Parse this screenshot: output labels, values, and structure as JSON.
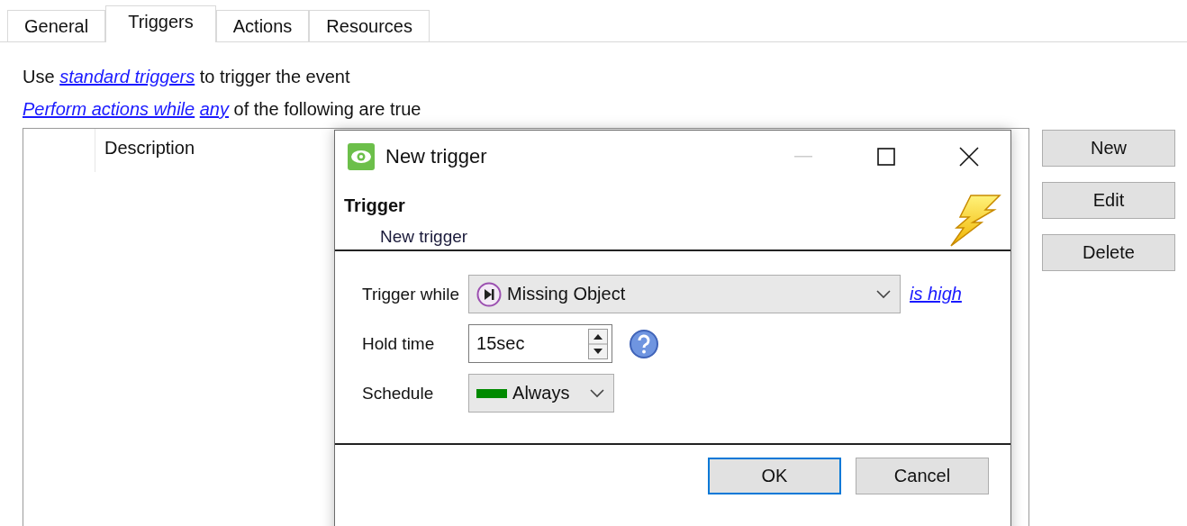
{
  "tabs": [
    {
      "label": "General",
      "selected": false
    },
    {
      "label": "Triggers",
      "selected": true
    },
    {
      "label": "Actions",
      "selected": false
    },
    {
      "label": "Resources",
      "selected": false
    }
  ],
  "trigger_line": {
    "prefix": "Use",
    "link": "standard triggers",
    "suffix": "to trigger the event"
  },
  "condition_line": {
    "link": "Perform actions while",
    "mode_link": "any",
    "suffix": "of the following are true"
  },
  "table": {
    "columns": [
      "Description"
    ]
  },
  "side_buttons": [
    "New",
    "Edit",
    "Delete"
  ],
  "dialog": {
    "title": "New trigger",
    "header": {
      "title": "Trigger",
      "subtitle": "New trigger"
    },
    "trigger_while": {
      "label": "Trigger while",
      "value": "Missing Object",
      "link": "is high"
    },
    "hold_time": {
      "label": "Hold time",
      "value": "15sec"
    },
    "schedule": {
      "label": "Schedule",
      "value": "Always"
    },
    "buttons": [
      {
        "label": "OK",
        "default": true
      },
      {
        "label": "Cancel",
        "default": false
      }
    ]
  }
}
